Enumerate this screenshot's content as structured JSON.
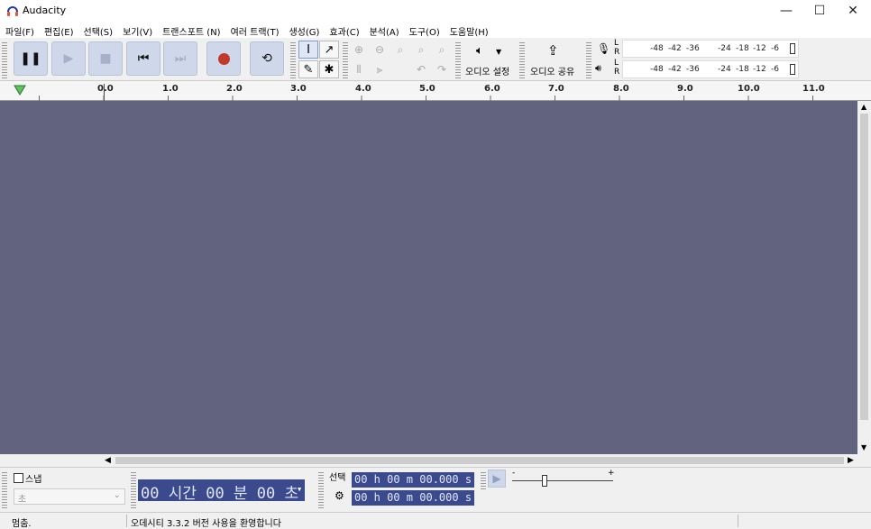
{
  "window": {
    "title": "Audacity",
    "minimize_glyph": "—",
    "maximize_glyph": "☐",
    "close_glyph": "✕"
  },
  "menu": [
    "파일(F)",
    "편집(E)",
    "선택(S)",
    "보기(V)",
    "트랜스포트 (N)",
    "여러 트랙(T)",
    "생성(G)",
    "효과(C)",
    "분석(A)",
    "도구(O)",
    "도움말(H)"
  ],
  "toolbar": {
    "audio_setup_label": "오디오 설정",
    "share_audio_label": "오디오 공유",
    "record_meter_ticks": [
      "-48",
      "-42",
      "-36",
      "-24",
      "-18",
      "-12",
      "-6"
    ],
    "play_meter_ticks": [
      "-48",
      "-42",
      "-36",
      "-24",
      "-18",
      "-12",
      "-6"
    ],
    "meter_L": "L",
    "meter_R": "R"
  },
  "ruler": {
    "labels": [
      "0.0",
      "1.0",
      "2.0",
      "3.0",
      "4.0",
      "5.0",
      "6.0",
      "7.0",
      "8.0",
      "9.0",
      "10.0",
      "11.0"
    ]
  },
  "bottom": {
    "snap_label": "스냅",
    "snap_unit": "초",
    "time_display": "00 시간 00 분 00 초",
    "selection_label": "선택",
    "selection_start": "00 h 00 m 00.000 s",
    "selection_end": "00 h 00 m 00.000 s",
    "speed_min": "-",
    "speed_max": "+"
  },
  "status": {
    "state": "멈춤.",
    "message": "오데시티 3.3.2 버전 사용을 환영합니다"
  },
  "colors": {
    "track_bg": "#62637f",
    "button_bg": "#cfd8ea",
    "record": "#c0392b",
    "time_bg": "#3b4a8c"
  }
}
